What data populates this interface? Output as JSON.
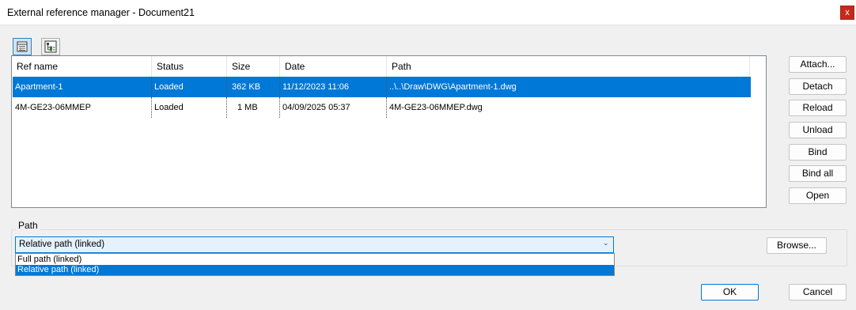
{
  "window": {
    "title": "External reference manager - Document21",
    "close_glyph": "x"
  },
  "view_buttons": [
    {
      "icon": "list-view-icon",
      "active": true
    },
    {
      "icon": "tree-view-icon",
      "active": false
    }
  ],
  "table": {
    "columns": [
      "Ref name",
      "Status",
      "Size",
      "Date",
      "Path"
    ],
    "rows": [
      {
        "name": "Apartment-1",
        "status": "Loaded",
        "size": "362 KB",
        "date": "11/12/2023 11:06",
        "path": "..\\..\\Draw\\DWG\\Apartment-1.dwg",
        "selected": true
      },
      {
        "name": "4M-GE23-06MMEP",
        "status": "Loaded",
        "size": "1 MB",
        "date": "04/09/2025 05:37",
        "path": "4M-GE23-06MMEP.dwg",
        "selected": false
      }
    ]
  },
  "actions": [
    "Attach...",
    "Detach",
    "Reload",
    "Unload",
    "Bind",
    "Bind all",
    "Open"
  ],
  "path_group": {
    "label": "Path",
    "selected_value": "Relative path (linked)",
    "options": [
      "Full path (linked)",
      "Relative path (linked)"
    ],
    "browse_label": "Browse..."
  },
  "footer": {
    "ok_label": "OK",
    "cancel_label": "Cancel"
  },
  "colors": {
    "selection": "#0078d7",
    "close_button": "#c42b1c"
  }
}
